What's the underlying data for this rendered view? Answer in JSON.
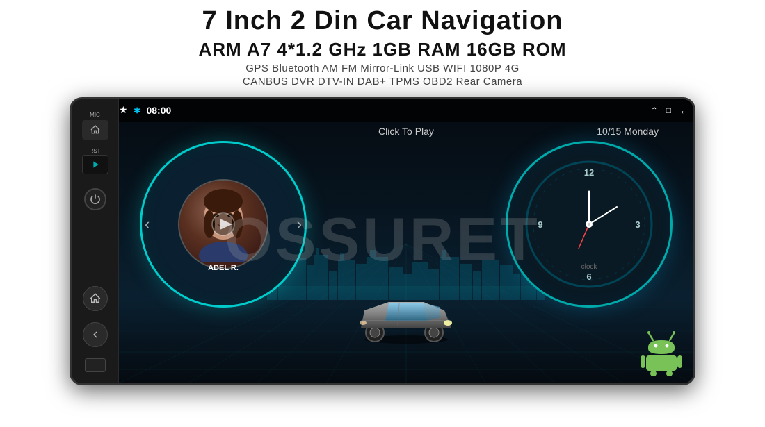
{
  "header": {
    "main_title": "7 Inch 2 Din Car Navigation",
    "specs": "ARM A7 4*1.2 GHz    1GB RAM    16GB ROM",
    "features_row1": "GPS  Bluetooth  AM  FM  Mirror-Link  USB  WIFI  1080P  4G",
    "features_row2": "CANBUS   DVR   DTV-IN   DAB+   TPMS   OBD2   Rear Camera"
  },
  "watermark": "OSSURET",
  "device": {
    "left_panel": {
      "mic_label": "MIC",
      "rst_label": "RST"
    },
    "screen": {
      "status_bar": {
        "bluetooth_icon": "bluetooth",
        "time": "08:00",
        "icons": [
          "▲",
          "▢",
          "←"
        ]
      },
      "music_player": {
        "click_to_play": "Click To Play",
        "artist": "ADEL R.",
        "prev_icon": "‹",
        "next_icon": "›"
      },
      "date": "10/15 Monday",
      "clock": {
        "label": "clock"
      }
    }
  },
  "colors": {
    "teal_accent": "#00cccc",
    "bg_dark": "#050a10",
    "panel_dark": "#1a1a1a"
  }
}
